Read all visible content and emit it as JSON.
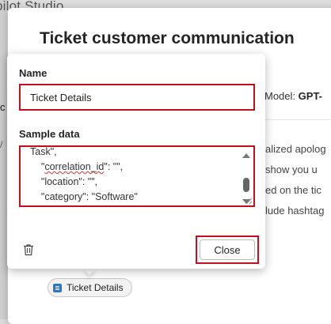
{
  "background": {
    "app_title": "pilot Studio",
    "left_char": "c"
  },
  "dialog": {
    "title": "Ticket customer communication",
    "model_label": "Model:",
    "model_value": "GPT-",
    "prompt_fragments": [
      "alized apolog",
      "show you u",
      "ed on the tic",
      "lude hashtag"
    ],
    "chip_label": "Ticket Details"
  },
  "popover": {
    "name_label": "Name",
    "name_value": "Ticket Details",
    "sample_label": "Sample data",
    "sample_lines": [
      "Task\",",
      "    \"correlation_id\": \"\",",
      "    \"location\": \"\",",
      "    \"category\": \"Software\"",
      "}"
    ],
    "close_label": "Close"
  },
  "colors": {
    "highlight": "#c4101d",
    "chip_icon": "#2a78c8"
  }
}
